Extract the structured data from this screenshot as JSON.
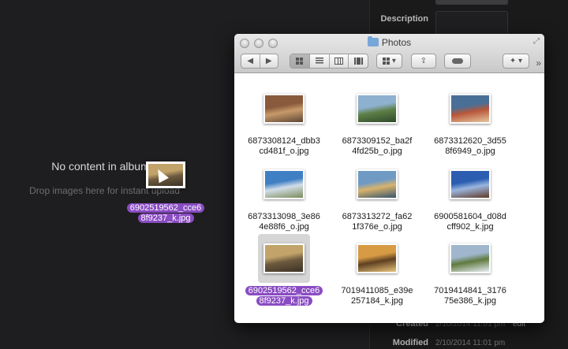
{
  "app": {
    "empty_title": "No content in album",
    "empty_subtitle": "Drop images here for instant upload"
  },
  "metadata": {
    "description_label": "Description",
    "created_label": "Created",
    "created_value": "2/10/2014 11:01 pm",
    "created_action": "edit",
    "modified_label": "Modified",
    "modified_value": "2/10/2014 11:01 pm"
  },
  "drag": {
    "label_line1": "6902519562_cce6",
    "label_line2": "8f9237_k.jpg"
  },
  "finder": {
    "title": "Photos",
    "icons": [
      "back-arrow",
      "forward-arrow",
      "icon-view",
      "list-view",
      "column-view",
      "coverflow-view",
      "arrange-menu",
      "share",
      "tags",
      "dropbox",
      "overflow-chevron"
    ],
    "files": [
      {
        "line1": "6873308124_dbb3",
        "line2": "cd481f_o.jpg",
        "colors": [
          "#8a5a3c",
          "#c79a6a",
          "#5e4636"
        ],
        "selected": false,
        "orientation": "landscape"
      },
      {
        "line1": "6873309152_ba2f",
        "line2": "4fd25b_o.jpg",
        "colors": [
          "#8eb1cf",
          "#5d7f46",
          "#2f4a2c"
        ],
        "selected": false,
        "orientation": "landscape"
      },
      {
        "line1": "6873312620_3d55",
        "line2": "8f6949_o.jpg",
        "colors": [
          "#4a6f96",
          "#b8573a",
          "#e6c6a0"
        ],
        "selected": false,
        "orientation": "landscape"
      },
      {
        "line1": "6873313098_3e86",
        "line2": "4e88f6_o.jpg",
        "colors": [
          "#3f7fc4",
          "#d3dde8",
          "#7a8c5a"
        ],
        "selected": false,
        "orientation": "landscape"
      },
      {
        "line1": "6873313272_fa62",
        "line2": "1f376e_o.jpg",
        "colors": [
          "#6e9ac4",
          "#d8b36d",
          "#35546b"
        ],
        "selected": false,
        "orientation": "landscape"
      },
      {
        "line1": "6900581604_d08d",
        "line2": "cff902_k.jpg",
        "colors": [
          "#2b5db1",
          "#9bb6df",
          "#5f3a26"
        ],
        "selected": false,
        "orientation": "landscape"
      },
      {
        "line1": "6902519562_cce6",
        "line2": "8f9237_k.jpg",
        "colors": [
          "#c2a36a",
          "#6d5a3e",
          "#3c3226"
        ],
        "selected": true,
        "orientation": "landscape"
      },
      {
        "line1": "7019411085_e39e",
        "line2": "257184_k.jpg",
        "colors": [
          "#d79b44",
          "#5d4021",
          "#e9c47a"
        ],
        "selected": false,
        "orientation": "landscape"
      },
      {
        "line1": "7019414841_3176",
        "line2": "75e386_k.jpg",
        "colors": [
          "#9fb6cc",
          "#5f7a3f",
          "#e8eef3"
        ],
        "selected": false,
        "orientation": "landscape"
      }
    ]
  }
}
